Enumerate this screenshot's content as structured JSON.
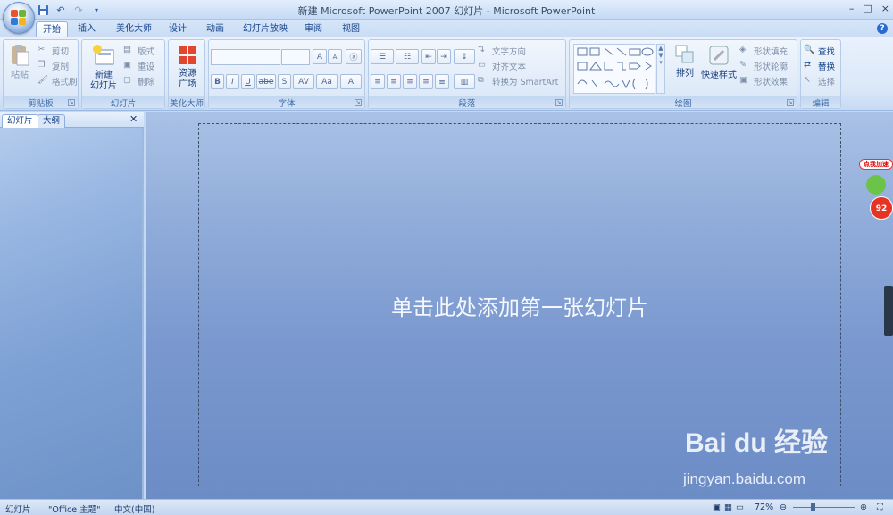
{
  "window": {
    "title": "新建 Microsoft PowerPoint 2007 幻灯片 - Microsoft PowerPoint",
    "controls": [
      "–",
      "□",
      "×"
    ]
  },
  "tabs": [
    "开始",
    "插入",
    "美化大师",
    "设计",
    "动画",
    "幻灯片放映",
    "审阅",
    "视图"
  ],
  "active_tab": "开始",
  "ribbon": {
    "clipboard": {
      "label": "剪贴板",
      "paste": "粘贴",
      "cut": "剪切",
      "copy": "复制",
      "format_painter": "格式刷"
    },
    "slides": {
      "label": "幻灯片",
      "new_slide": "新建\n幻灯片",
      "new_slide_l1": "新建",
      "new_slide_l2": "幻灯片",
      "layout": "版式",
      "reset": "重设",
      "delete": "删除"
    },
    "beautify": {
      "label": "美化大师",
      "resource_l1": "资源",
      "resource_l2": "广场"
    },
    "font": {
      "label": "字体",
      "bold": "B",
      "italic": "I",
      "underline": "U",
      "strike": "abe",
      "shadow": "S",
      "spacing": "AV",
      "case": "Aa",
      "color": "A",
      "grow": "A",
      "shrink": "A"
    },
    "paragraph": {
      "label": "段落",
      "text_direction": "文字方向",
      "align_text": "对齐文本",
      "convert_smartart": "转换为 SmartArt"
    },
    "drawing": {
      "label": "绘图",
      "arrange": "排列",
      "quick_styles": "快速样式",
      "shape_fill": "形状填充",
      "shape_outline": "形状轮廓",
      "shape_effects": "形状效果"
    },
    "editing": {
      "label": "编辑",
      "find": "查找",
      "replace": "替换",
      "select": "选择"
    }
  },
  "pane": {
    "tab_slides": "幻灯片",
    "tab_outline": "大纲",
    "close": "✕"
  },
  "slide": {
    "placeholder": "单击此处添加第一张幻灯片"
  },
  "status": {
    "slide": "幻灯片",
    "theme": "\"Office 主题\"",
    "language": "中文(中国)",
    "zoom": "72%"
  },
  "badge": {
    "text": "点我加速",
    "number": "92"
  },
  "watermark": {
    "brand": "Bai du 经验",
    "url": "jingyan.baidu.com"
  }
}
